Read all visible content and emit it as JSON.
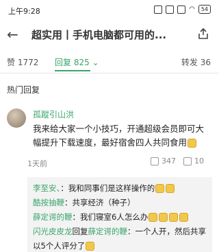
{
  "status_bar": {
    "time": "上午9:28",
    "battery": "54"
  },
  "header": {
    "title": "超实用丨手机电脑都可用的..."
  },
  "stats": {
    "likes": "赞 1772",
    "replies": "回复 825 ⌄",
    "reposts": "转发 36"
  },
  "section": {
    "title": "热门回复"
  },
  "comment": {
    "username": "孤蹤引山洪",
    "text": "我来给大家一个小技巧，开通超级会员即可大幅提升下载速度，最好宿舍四人共同食用",
    "time": "1天前",
    "like_count": "347",
    "reply_count": "10"
  },
  "replies": [
    {
      "user": "李至安、",
      "text": "：我和同事们是这样操作的"
    },
    {
      "user": "酷按抽鞭",
      "text": "：共享经济（种子）"
    },
    {
      "user": "薛定谔的鞭",
      "text": "：我们寝室6人怎么办"
    },
    {
      "user": "闪光皮皮龙",
      "mid": "回复",
      "target": "薛定谔的鞭",
      "text": "：一个人开，然后共享"
    },
    {
      "text": "以5个人评分了"
    }
  ]
}
